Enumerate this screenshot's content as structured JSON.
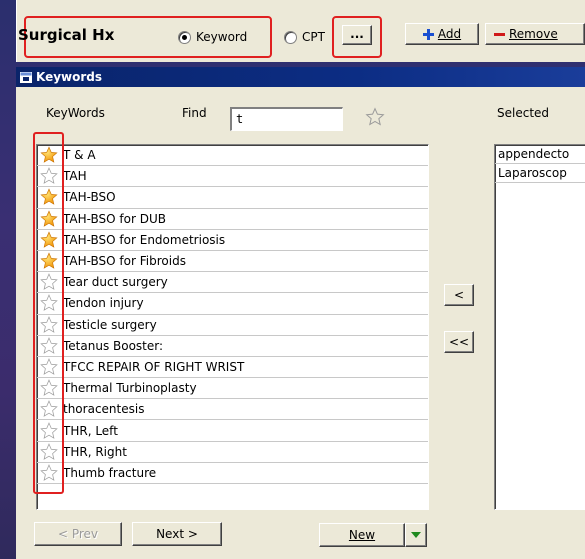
{
  "toolbar": {
    "title": "Surgical Hx",
    "radio_keyword": "Keyword",
    "radio_cpt": "CPT",
    "browse_label": "...",
    "add_label": "Add",
    "remove_label": "Remove"
  },
  "panel": {
    "header": "Keywords",
    "keywords_label": "KeyWords",
    "find_label": "Find",
    "find_value": "t",
    "selected_label": "Selected"
  },
  "keywords": [
    {
      "label": "T & A",
      "favorite": true
    },
    {
      "label": "TAH",
      "favorite": false
    },
    {
      "label": "TAH-BSO",
      "favorite": true
    },
    {
      "label": "TAH-BSO for DUB",
      "favorite": true
    },
    {
      "label": "TAH-BSO for Endometriosis",
      "favorite": true
    },
    {
      "label": "TAH-BSO for Fibroids",
      "favorite": true
    },
    {
      "label": "Tear duct surgery",
      "favorite": false
    },
    {
      "label": "Tendon injury",
      "favorite": false
    },
    {
      "label": "Testicle surgery",
      "favorite": false
    },
    {
      "label": "Tetanus Booster:",
      "favorite": false
    },
    {
      "label": "TFCC REPAIR OF RIGHT WRIST",
      "favorite": false
    },
    {
      "label": "Thermal Turbinoplasty",
      "favorite": false
    },
    {
      "label": "thoracentesis",
      "favorite": false
    },
    {
      "label": "THR, Left",
      "favorite": false
    },
    {
      "label": "THR, Right",
      "favorite": false
    },
    {
      "label": "Thumb fracture",
      "favorite": false
    }
  ],
  "selected": [
    {
      "label": "appendecto"
    },
    {
      "label": "Laparoscop"
    }
  ],
  "buttons": {
    "move_one": "<",
    "move_all": "<<",
    "prev": "< Prev",
    "next": "Next >",
    "new": "New"
  },
  "colors": {
    "highlight_outline": "#e02020",
    "header_bg": "#0a246a",
    "window_bg": "#ece9d8",
    "star_fill": "#f5a800"
  },
  "icons": {
    "favorite": "star-filled-icon",
    "not_favorite": "star-outline-icon",
    "add": "plus-icon",
    "remove": "minus-icon",
    "panel": "window-icon",
    "dropdown": "triangle-down-icon"
  }
}
